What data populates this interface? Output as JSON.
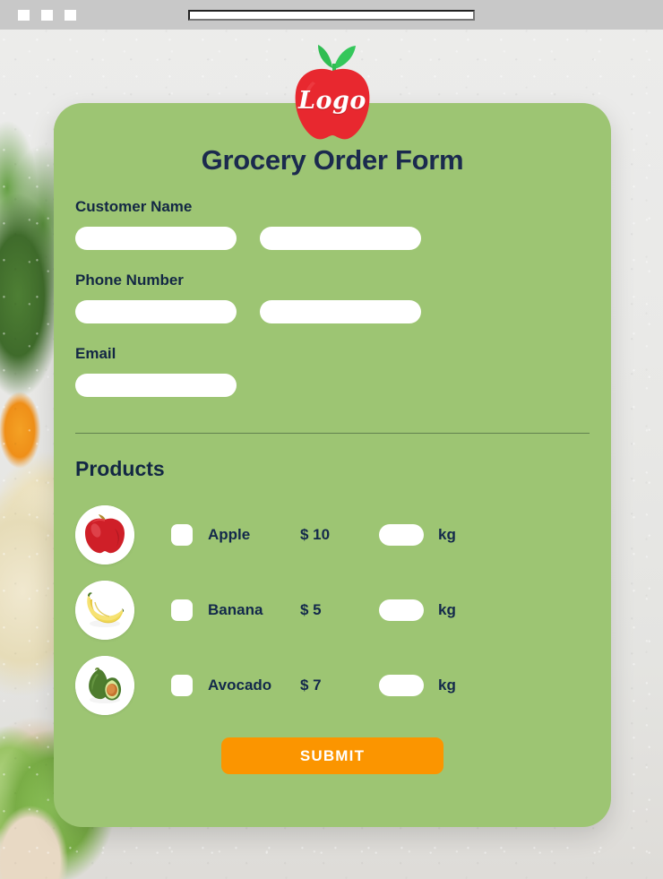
{
  "browser": {
    "window_dots": [
      "dot-1",
      "dot-2",
      "dot-3"
    ],
    "address_bar_value": "",
    "address_bar_placeholder": ""
  },
  "logo": {
    "text": "Logo",
    "icon": "apple-logo-icon",
    "apple_color": "#e8282f",
    "leaf_color": "#2fbd52"
  },
  "form": {
    "title": "Grocery Order Form",
    "card_color": "#9dc573",
    "heading_color": "#1b2a4e",
    "fields": [
      {
        "label": "Customer Name",
        "inputs": [
          {
            "name": "customer-first-name-input",
            "value": "",
            "placeholder": ""
          },
          {
            "name": "customer-last-name-input",
            "value": "",
            "placeholder": ""
          }
        ]
      },
      {
        "label": "Phone Number",
        "inputs": [
          {
            "name": "phone-area-code-input",
            "value": "",
            "placeholder": ""
          },
          {
            "name": "phone-number-input",
            "value": "",
            "placeholder": ""
          }
        ]
      },
      {
        "label": "Email",
        "inputs": [
          {
            "name": "email-input",
            "value": "",
            "placeholder": ""
          }
        ]
      }
    ],
    "products_heading": "Products",
    "products": [
      {
        "icon": "apple-photo-icon",
        "name": "Apple",
        "price": "$ 10",
        "quantity": "",
        "quantity_placeholder": "",
        "unit": "kg",
        "checked": false
      },
      {
        "icon": "banana-photo-icon",
        "name": "Banana",
        "price": "$ 5",
        "quantity": "",
        "quantity_placeholder": "",
        "unit": "kg",
        "checked": false
      },
      {
        "icon": "avocado-photo-icon",
        "name": "Avocado",
        "price": "$ 7",
        "quantity": "",
        "quantity_placeholder": "",
        "unit": "kg",
        "checked": false
      }
    ],
    "submit_label": "SUBMIT",
    "submit_color": "#fb9500"
  }
}
